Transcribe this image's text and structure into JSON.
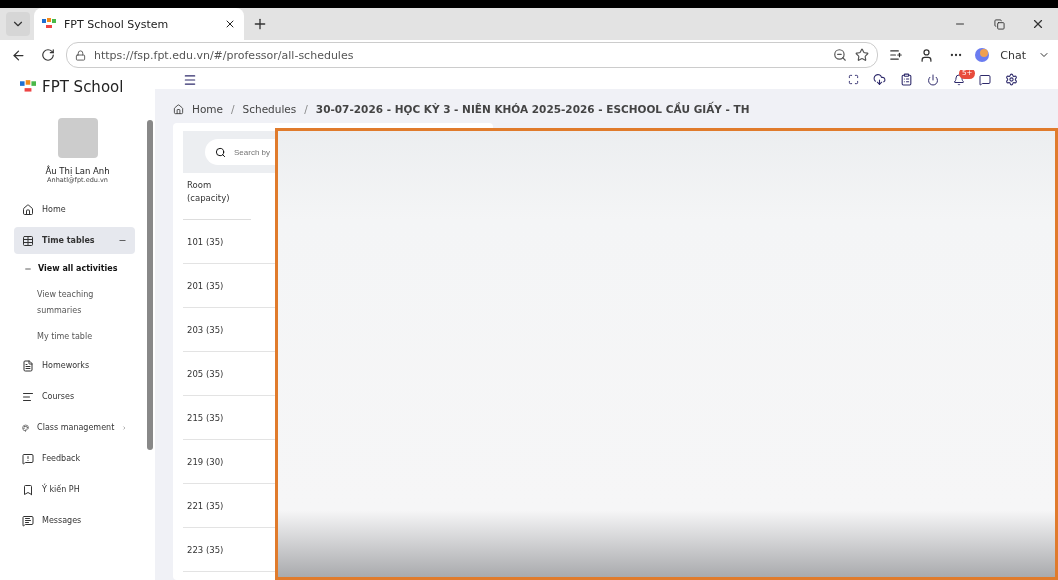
{
  "browser": {
    "tab": {
      "title": "FPT School System"
    },
    "url": "https://fsp.fpt.edu.vn/#/professor/all-schedules",
    "chat": "Chat"
  },
  "app": {
    "brand": "FPT School",
    "notification_badge": "5+"
  },
  "user": {
    "name": "Âu Thị Lan Anh",
    "email": "Anhatl@fpt.edu.vn"
  },
  "sidebar": {
    "items": [
      {
        "label": "Home",
        "selected": false
      },
      {
        "label": "Time tables",
        "selected": true,
        "expanded": true,
        "children": [
          {
            "label": "View all activities",
            "selected": true
          },
          {
            "label": "View teaching summaries",
            "selected": false
          },
          {
            "label": "My time table",
            "selected": false
          }
        ]
      },
      {
        "label": "Homeworks",
        "selected": false
      },
      {
        "label": "Courses",
        "selected": false
      },
      {
        "label": "Class management",
        "selected": false,
        "has_submenu": true
      },
      {
        "label": "Feedback",
        "selected": false
      },
      {
        "label": "Ý kiến PH",
        "selected": false
      },
      {
        "label": "Messages",
        "selected": false
      }
    ]
  },
  "breadcrumb": [
    {
      "kind": "link",
      "text": "Home"
    },
    {
      "kind": "separator",
      "text": "/"
    },
    {
      "kind": "link",
      "text": "Schedules"
    },
    {
      "kind": "separator",
      "text": "/"
    },
    {
      "kind": "current",
      "text": "30-07-2026 - HỌC KỲ 3 - NIÊN KHÓA 2025-2026 - ESCHOOL CẦU GIẤY - TH"
    }
  ],
  "search": {
    "placeholder": "Search by"
  },
  "table": {
    "columns": [
      "Room (capacity)"
    ],
    "rows": [
      "101 (35)",
      "201 (35)",
      "203 (35)",
      "205 (35)",
      "215 (35)",
      "219 (30)",
      "221 (35)",
      "223 (35)"
    ]
  }
}
